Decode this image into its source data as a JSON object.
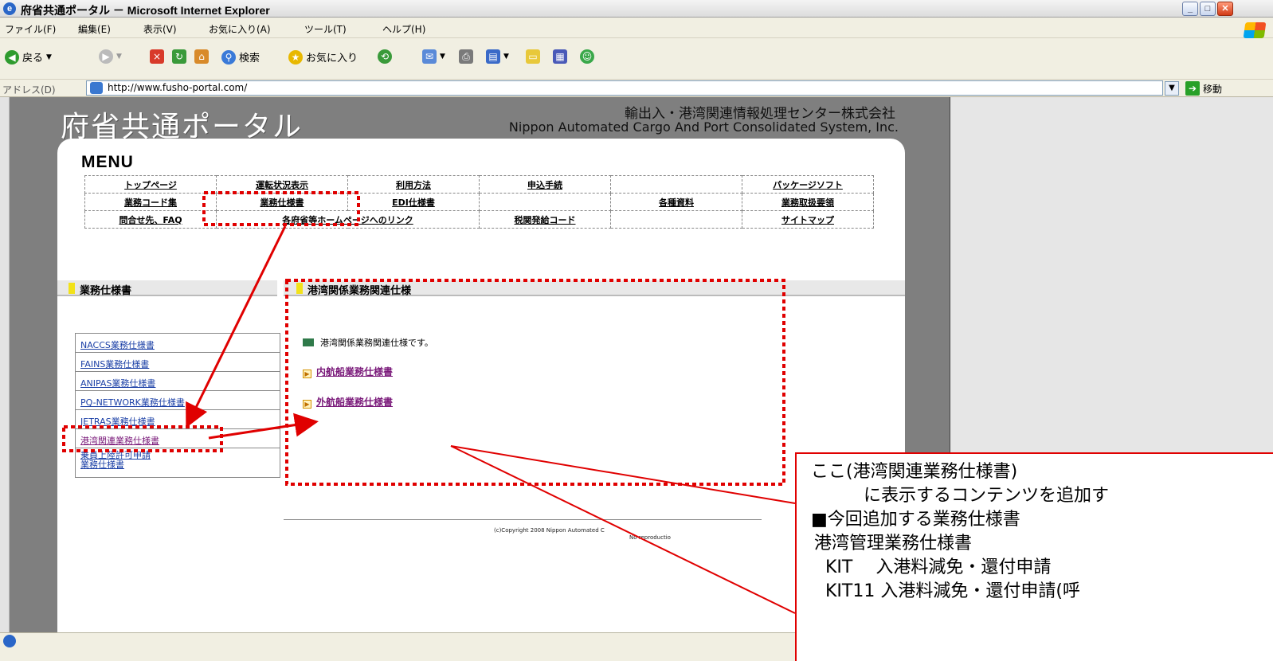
{
  "window": {
    "title": "府省共通ポータル － Microsoft Internet Explorer",
    "buttons": [
      "_",
      "□",
      "✕"
    ]
  },
  "menubar": [
    "ファイル(F)",
    "編集(E)",
    "表示(V)",
    "お気に入り(A)",
    "ツール(T)",
    "ヘルプ(H)"
  ],
  "toolbar": {
    "back": "戻る",
    "search": "検索",
    "favorites": "お気に入り"
  },
  "address": {
    "label": "アドレス(D)",
    "url": "http://www.fusho-portal.com/",
    "go": "移動"
  },
  "site": {
    "logo": "府省共通ポータル",
    "company_jp": "輸出入・港湾関連情報処理センター株式会社",
    "company_en": "Nippon Automated Cargo And Port Consolidated System, Inc.",
    "menu_title": "MENU",
    "menu_rows": [
      [
        "トップページ",
        "運転状況表示",
        "利用方法",
        "申込手続",
        "",
        "パッケージソフト"
      ],
      [
        "業務コード集",
        "業務仕様書",
        "EDI仕様書",
        "",
        "各種資料",
        "業務取扱要領"
      ],
      [
        "問合せ先、FAQ",
        "各府省等ホームページへのリンク",
        "",
        "税関発給コード",
        "",
        "サイトマップ"
      ]
    ],
    "left_section": "業務仕様書",
    "main_section": "港湾関係業務関連仕様",
    "sidelist": [
      "NACCS業務仕様書",
      "FAINS業務仕様書",
      "ANIPAS業務仕様書",
      "PQ-NETWORK業務仕様書",
      "JETRAS業務仕様書",
      "港湾関連業務仕様書",
      "乗員上陸許可申請",
      "業務仕様書"
    ],
    "intro": "港湾関係業務関連仕様です。",
    "links": [
      "内航船業務仕様書",
      "外航船業務仕様書"
    ],
    "copyright": "(c)Copyright 2008 Nippon Automated C",
    "copyright2": "No reproductio"
  },
  "callout": {
    "line1": "ここ(港湾関連業務仕様書)",
    "line2": "に表示するコンテンツを追加す",
    "line3": "■今回追加する業務仕様書",
    "line4": "港湾管理業務仕様書",
    "line5": "KIT　 入港料減免・還付申請",
    "line6": "KIT11  入港料減免・還付申請(呼"
  },
  "colors": {
    "annotation": "#e00000",
    "site_bg": "#7f7f7f",
    "section_marker": "#f2e21a"
  }
}
